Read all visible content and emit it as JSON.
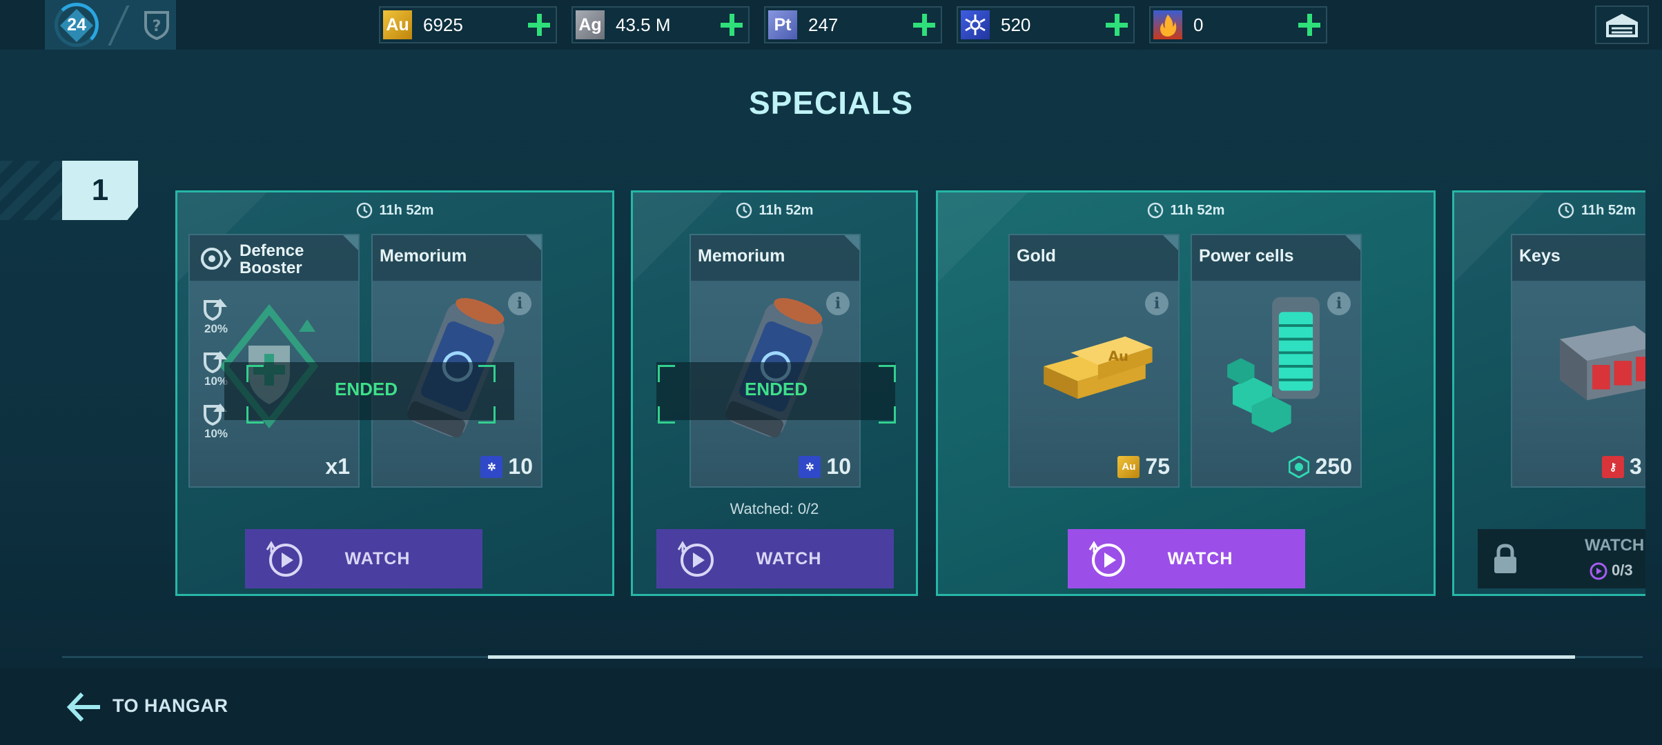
{
  "player": {
    "level": "24"
  },
  "resources": [
    {
      "icon": "gold-au-icon",
      "symbol": "Au",
      "value": "6925",
      "color": "#d9a31a"
    },
    {
      "icon": "silver-ag-icon",
      "symbol": "Ag",
      "value": "43.5 M",
      "color": "#8c8f96"
    },
    {
      "icon": "platinum-pt-icon",
      "symbol": "Pt",
      "value": "247",
      "color": "#6273c4"
    },
    {
      "icon": "memorium-icon",
      "symbol": "",
      "value": "520",
      "color": "#2f49c9"
    },
    {
      "icon": "fire-token-icon",
      "symbol": "",
      "value": "0",
      "color": "#e0552a"
    }
  ],
  "title": "SPECIALS",
  "page": "1",
  "offers": [
    {
      "timer": "11h 52m",
      "items": [
        {
          "name": "Defence\nBooster",
          "name_line1": "Defence",
          "name_line2": "Booster",
          "quantity": "x1",
          "stats": [
            "20%",
            "10%",
            "10%"
          ]
        },
        {
          "name": "Memorium",
          "quantity": "10",
          "currency_icon": "memorium-icon"
        }
      ],
      "status": "ENDED",
      "button": "WATCH"
    },
    {
      "timer": "11h 52m",
      "items": [
        {
          "name": "Memorium",
          "quantity": "10",
          "currency_icon": "memorium-icon"
        }
      ],
      "status": "ENDED",
      "watched": "Watched: 0/2",
      "button": "WATCH"
    },
    {
      "timer": "11h 52m",
      "items": [
        {
          "name": "Gold",
          "quantity": "75",
          "currency_symbol": "Au"
        },
        {
          "name": "Power cells",
          "quantity": "250",
          "currency_icon": "power-cell-icon"
        }
      ],
      "button": "WATCH"
    },
    {
      "timer": "11h 52m",
      "items": [
        {
          "name": "Keys",
          "quantity": "3",
          "currency_icon": "key-icon"
        }
      ],
      "button": "WATCH",
      "locked_count": "0/3"
    }
  ],
  "scroll_progress": 0.67,
  "back": {
    "label": "TO HANGAR"
  },
  "colors": {
    "accent": "#27b7a6",
    "ended": "#3ee089",
    "watch": "#4a3fa0",
    "watch_active": "#9b4fe8",
    "plus": "#2fe07a"
  }
}
